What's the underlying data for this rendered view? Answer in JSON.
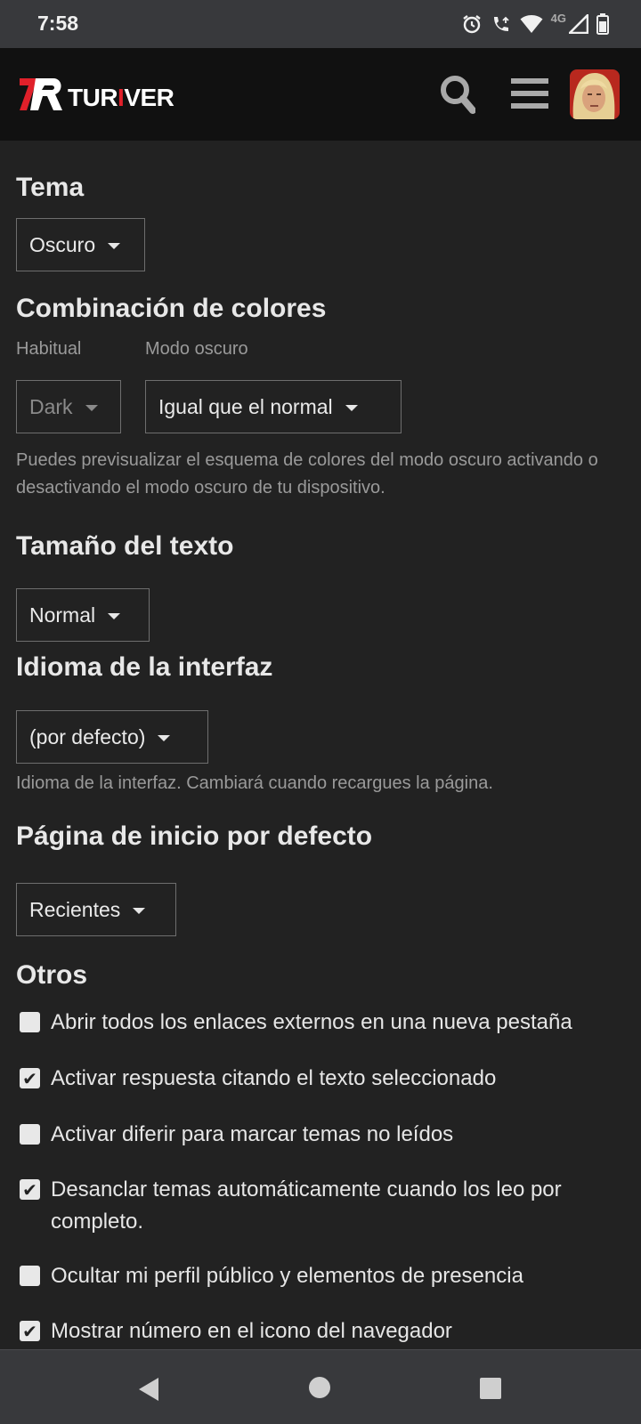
{
  "status_bar": {
    "time": "7:58",
    "network": "4G",
    "icons": [
      "alarm-icon",
      "wifi-calling-icon",
      "wifi-icon",
      "signal-icon",
      "battery-icon"
    ]
  },
  "header": {
    "logo_mark": "7R",
    "logo_text_a": "TUR",
    "logo_text_b": "I",
    "logo_text_c": "VER",
    "accent_color": "#e0202a",
    "icons": [
      "search-icon",
      "menu-icon",
      "avatar"
    ]
  },
  "sections": {
    "tema": {
      "heading": "Tema",
      "value": "Oscuro"
    },
    "colores": {
      "heading": "Combinación de colores",
      "habitual_label": "Habitual",
      "habitual_value": "Dark",
      "dark_label": "Modo oscuro",
      "dark_value": "Igual que el normal",
      "description": "Puedes previsualizar el esquema de colores del modo oscuro activando o desactivando el modo oscuro de tu dispositivo."
    },
    "texto": {
      "heading": "Tamaño del texto",
      "value": "Normal"
    },
    "idioma": {
      "heading": "Idioma de la interfaz",
      "value": "(por defecto)",
      "description": "Idioma de la interfaz. Cambiará cuando recargues la página."
    },
    "inicio": {
      "heading": "Página de inicio por defecto",
      "value": "Recientes"
    },
    "otros": {
      "heading": "Otros",
      "options": [
        {
          "label": "Abrir todos los enlaces externos en una nueva pestaña",
          "checked": false
        },
        {
          "label": "Activar respuesta citando el texto seleccionado",
          "checked": true
        },
        {
          "label": "Activar diferir para marcar temas no leídos",
          "checked": false
        },
        {
          "label": "Desanclar temas automáticamente cuando los leo por completo.",
          "checked": true
        },
        {
          "label": "Ocultar mi perfil público y elementos de presencia",
          "checked": false
        },
        {
          "label": "Mostrar número en el icono del navegador",
          "checked": true
        }
      ]
    }
  },
  "nav_bar": {
    "icons": [
      "back-icon",
      "home-icon",
      "recents-icon"
    ]
  }
}
